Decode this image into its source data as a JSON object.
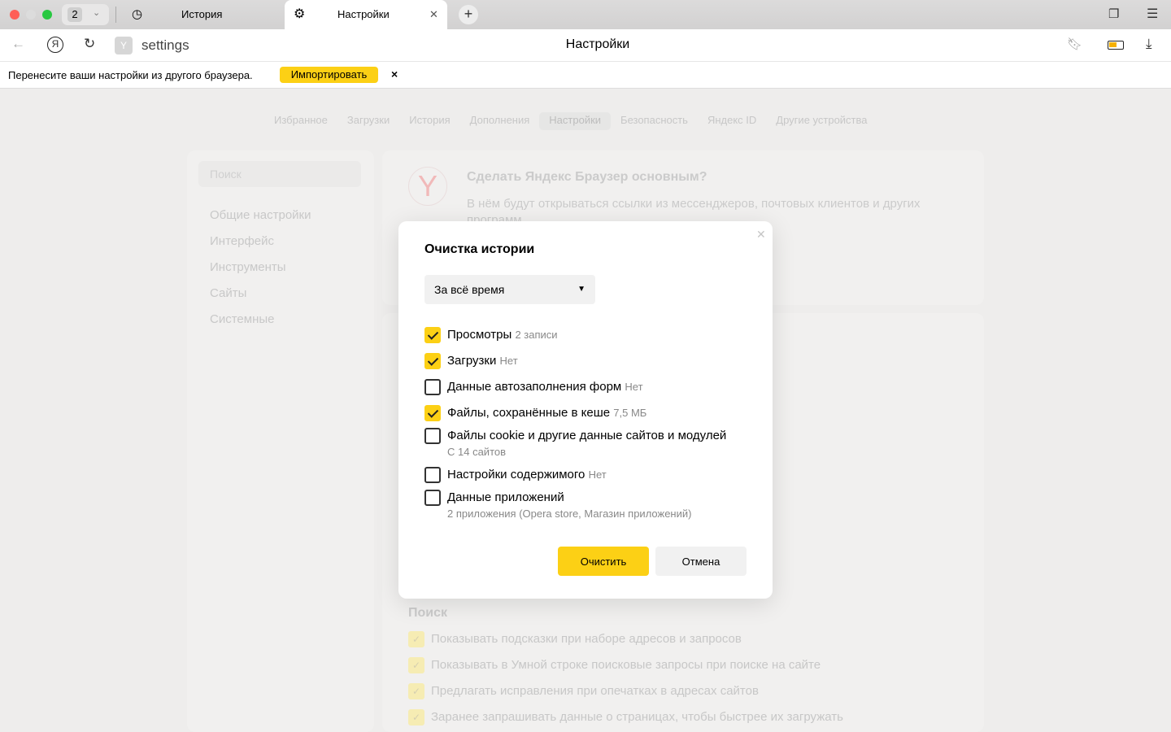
{
  "tabbar": {
    "tab_count": "2",
    "tabs": [
      {
        "label": "История"
      },
      {
        "label": "Настройки"
      }
    ]
  },
  "address": {
    "url": "settings",
    "page_title": "Настройки"
  },
  "infobar": {
    "text": "Перенесите ваши настройки из другого браузера.",
    "import_label": "Импортировать",
    "close": "×"
  },
  "nav": [
    "Избранное",
    "Загрузки",
    "История",
    "Дополнения",
    "Настройки",
    "Безопасность",
    "Яндекс ID",
    "Другие устройства"
  ],
  "sidebar": {
    "search_placeholder": "Поиск",
    "items": [
      "Общие настройки",
      "Интерфейс",
      "Инструменты",
      "Сайты",
      "Системные"
    ]
  },
  "promo": {
    "title": "Сделать Яндекс Браузер основным?",
    "text": "В нём будут открываться ссылки из мессенджеров, почтовых клиентов и других программ"
  },
  "search_section": {
    "title": "Поиск",
    "options": [
      "Показывать подсказки при наборе адресов и запросов",
      "Показывать в Умной строке поисковые запросы при поиске на сайте",
      "Предлагать исправления при опечатках в адресах сайтов",
      "Заранее запрашивать данные о страницах, чтобы быстрее их загружать"
    ]
  },
  "modal": {
    "title": "Очистка истории",
    "period": "За всё время",
    "options": [
      {
        "label": "Просмотры",
        "note": "2 записи",
        "checked": true
      },
      {
        "label": "Загрузки",
        "note": "Нет",
        "checked": true
      },
      {
        "label": "Данные автозаполнения форм",
        "note": "Нет",
        "checked": false
      },
      {
        "label": "Файлы, сохранённые в кеше",
        "note": "7,5 МБ",
        "checked": true
      },
      {
        "label": "Файлы cookie и другие данные сайтов и модулей",
        "note": "С 14 сайтов",
        "checked": false
      },
      {
        "label": "Настройки содержимого",
        "note": "Нет",
        "checked": false
      },
      {
        "label": "Данные приложений",
        "note": "2 приложения (Opera store, Магазин приложений)",
        "checked": false
      }
    ],
    "clear_label": "Очистить",
    "cancel_label": "Отмена"
  },
  "colors": {
    "accent": "#fcd015"
  }
}
